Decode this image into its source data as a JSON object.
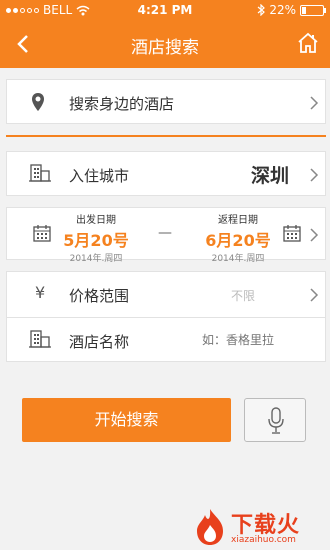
{
  "status": {
    "carrier": "BELL",
    "time": "4:21 PM",
    "battery": "22%",
    "battery_level": 0.22
  },
  "nav": {
    "title": "酒店搜索",
    "back_icon": "chevron-left-icon",
    "home_icon": "home-icon"
  },
  "nearby": {
    "label": "搜索身边的酒店",
    "icon": "location-pin-icon"
  },
  "city": {
    "label": "入住城市",
    "value": "深圳",
    "icon": "building-icon"
  },
  "dates": {
    "depart": {
      "caption": "出发日期",
      "date": "5月20号",
      "sub": "2014年.周四"
    },
    "separator": "—",
    "return": {
      "caption": "返程日期",
      "date": "6月20号",
      "sub": "2014年.周四"
    }
  },
  "price": {
    "label": "价格范围",
    "value": "不限",
    "icon": "yen-icon"
  },
  "hotel_name": {
    "label": "酒店名称",
    "placeholder": "如：香格里拉",
    "icon": "building-icon"
  },
  "search_button": "开始搜索",
  "voice_icon": "microphone-icon",
  "watermark": {
    "brand": "下载火",
    "url": "xiazaihuo.com"
  },
  "colors": {
    "accent": "#f5821f",
    "background": "#f2f2f2"
  }
}
